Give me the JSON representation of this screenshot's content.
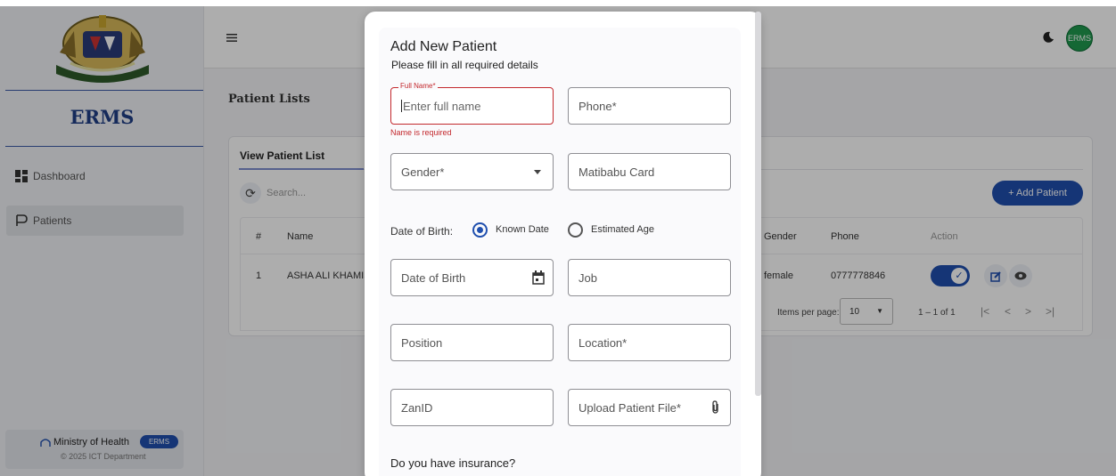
{
  "app": {
    "brand": "ERMS",
    "nav": [
      {
        "label": "Dashboard",
        "icon": "dashboard-icon"
      },
      {
        "label": "Patients",
        "icon": "patients-icon"
      }
    ],
    "footer": {
      "title": "Ministry of Health",
      "badge": "ERMS",
      "subtitle": "© 2025 ICT Department"
    },
    "avatar_label": "ERMS",
    "accent_color": "#1f4fae"
  },
  "page": {
    "title": "Patient Lists",
    "card_tab": "View Patient List",
    "search_placeholder": "Search...",
    "add_button": "+ Add Patient",
    "table": {
      "headers": [
        "#",
        "Name",
        "Gender",
        "Phone",
        "Action"
      ],
      "rows": [
        {
          "num": "1",
          "name": "ASHA ALI KHAMIS",
          "gender": "female",
          "phone": "0777778846"
        }
      ]
    },
    "pagination": {
      "items_per_page_label": "Items per page:",
      "items_per_page": "10",
      "range": "1 – 1 of 1"
    }
  },
  "modal": {
    "title": "Add New Patient",
    "subtitle": "Please fill in all required details",
    "full_name": {
      "label": "Full Name*",
      "placeholder": "Enter full name",
      "error": "Name is required"
    },
    "phone": "Phone*",
    "gender": "Gender*",
    "matibabu": "Matibabu Card",
    "dob_label": "Date of Birth:",
    "radio_known": "Known Date",
    "radio_estimated": "Estimated Age",
    "date_of_birth": "Date of Birth",
    "job": "Job",
    "position": "Position",
    "location": "Location*",
    "zanid": "ZanID",
    "upload": "Upload Patient File*",
    "insurance_question": "Do you have insurance?"
  }
}
